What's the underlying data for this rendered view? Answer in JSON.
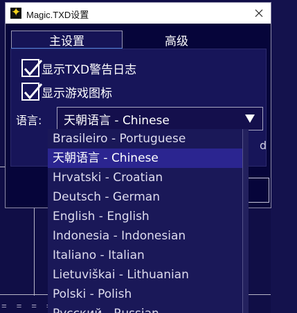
{
  "window": {
    "title": "Magic.TXD设置",
    "close_glyph": "✕"
  },
  "tabs": [
    {
      "label": "主设置",
      "active": true
    },
    {
      "label": "高级",
      "active": false
    }
  ],
  "options": {
    "show_txd_warning_log": {
      "label": "显示TXD警告日志",
      "checked": true
    },
    "show_game_icons": {
      "label": "显示游戏图标",
      "checked": true
    }
  },
  "language": {
    "label": "语言:",
    "selected": "天朝语言 - Chinese",
    "options": [
      "Brasileiro - Portuguese",
      "天朝语言 - Chinese",
      "Hrvatski - Croatian",
      "Deutsch - German",
      "English - English",
      "Indonesia - Indonesian",
      "Italiano - Italian",
      "Lietuviškai - Lithuanian",
      "Polski - Polish",
      "Русский - Russian"
    ],
    "selected_index": 1
  },
  "partial": {
    "clipped_char": "d"
  },
  "background": {
    "bottom_text": "= = = ="
  },
  "colors": {
    "background": "#12104a",
    "panel": "#171559",
    "selection": "#2b2590",
    "accent": "#4f7fd6",
    "title_bar": "#ffffff"
  }
}
